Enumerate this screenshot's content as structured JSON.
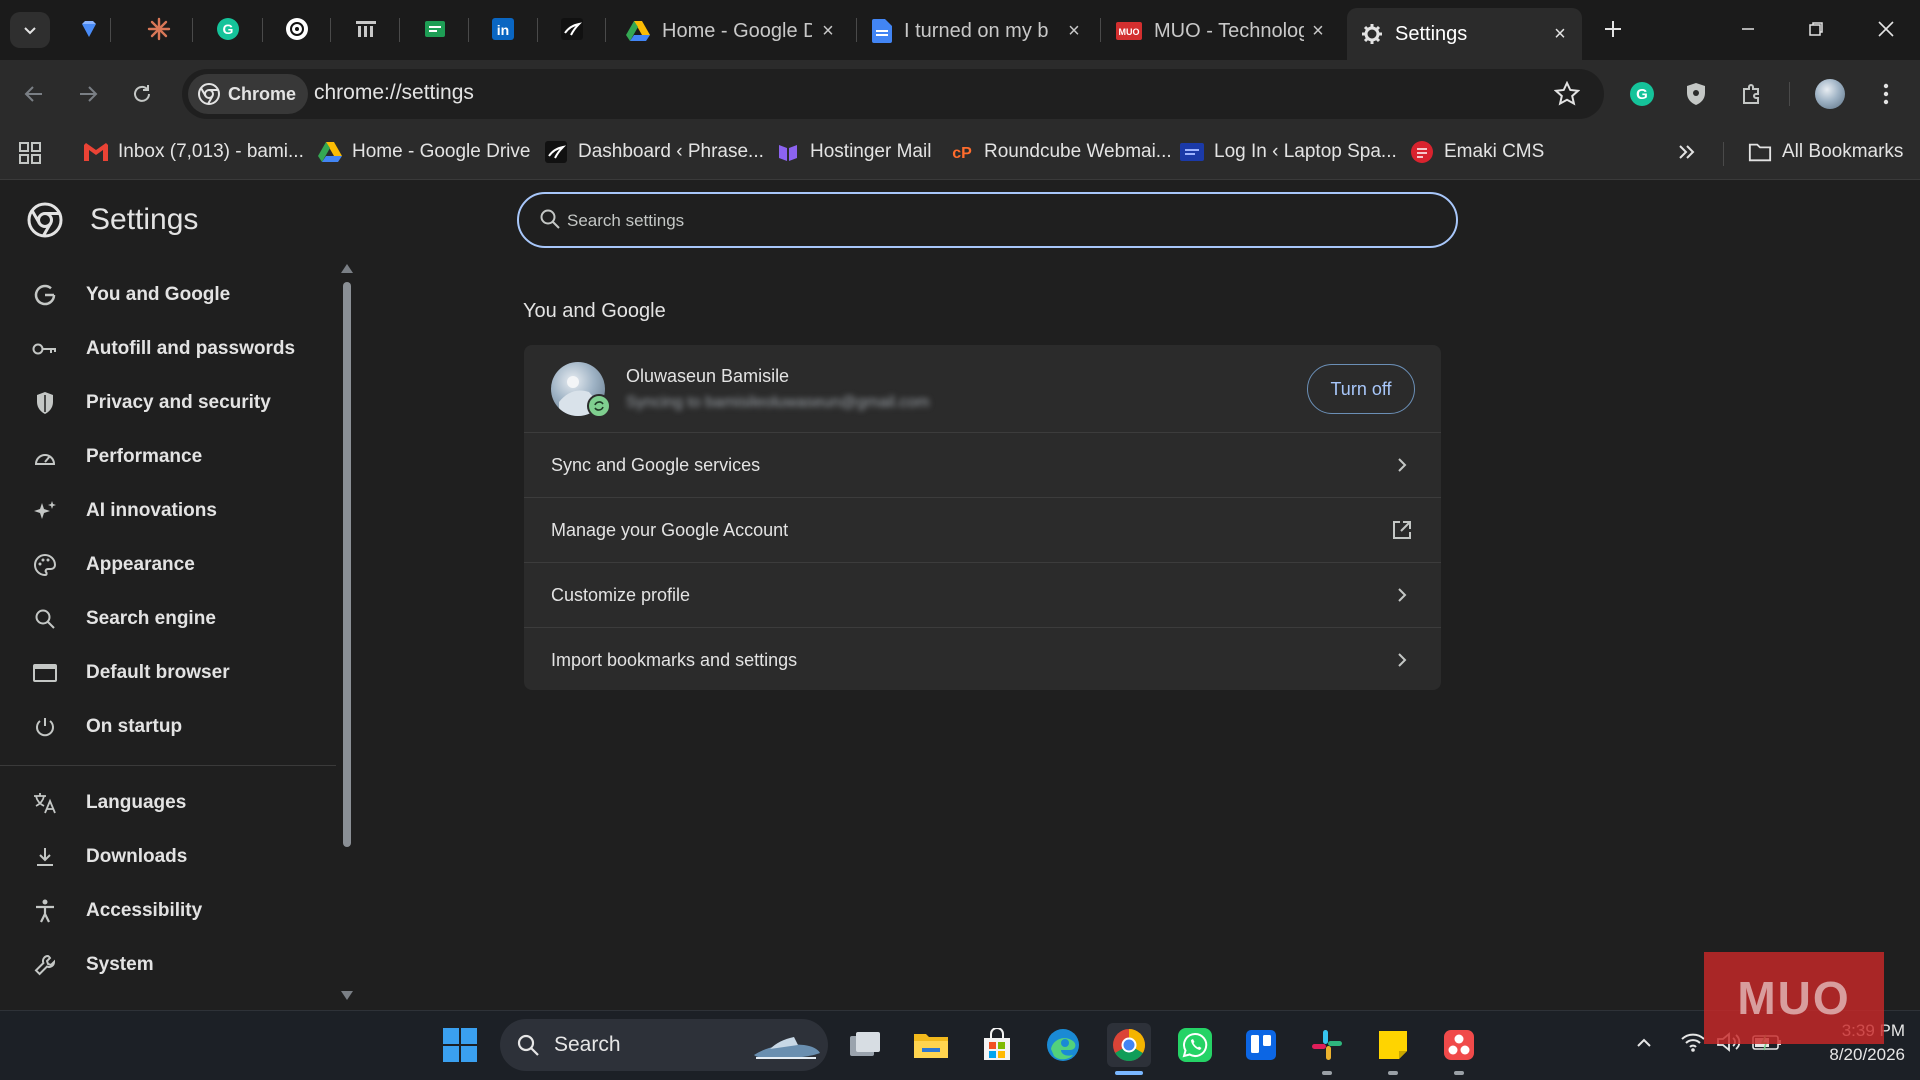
{
  "tabs": {
    "pinned_icons": [
      "gemini-icon",
      "claude-icon",
      "grammarly-icon",
      "chatgpt-icon",
      "columns-icon",
      "sheets-icon",
      "linkedin-icon",
      "site-icon"
    ],
    "open": [
      {
        "title": "Home - Google D",
        "icon": "google-drive-icon"
      },
      {
        "title": "I turned on my b",
        "icon": "google-docs-icon"
      },
      {
        "title": "MUO - Technolog",
        "icon": "muo-icon"
      },
      {
        "title": "Settings",
        "icon": "gear-icon",
        "active": true
      }
    ]
  },
  "toolbar": {
    "chip_label": "Chrome",
    "url": "chrome://settings"
  },
  "bookmarks": {
    "items": [
      {
        "label": "Inbox (7,013) - bami...",
        "icon": "gmail-icon"
      },
      {
        "label": "Home - Google Drive",
        "icon": "google-drive-icon"
      },
      {
        "label": "Dashboard ‹ Phrase...",
        "icon": "site-icon"
      },
      {
        "label": "Hostinger Mail",
        "icon": "hostinger-icon"
      },
      {
        "label": "Roundcube Webmai...",
        "icon": "cpanel-icon"
      },
      {
        "label": "Log In ‹ Laptop Spa...",
        "icon": "site-icon"
      },
      {
        "label": "Emaki CMS",
        "icon": "emaki-icon"
      }
    ],
    "all_bookmarks": "All Bookmarks"
  },
  "sidebar": {
    "title": "Settings",
    "items": [
      {
        "label": "You and Google"
      },
      {
        "label": "Autofill and passwords"
      },
      {
        "label": "Privacy and security"
      },
      {
        "label": "Performance"
      },
      {
        "label": "AI innovations"
      },
      {
        "label": "Appearance"
      },
      {
        "label": "Search engine"
      },
      {
        "label": "Default browser"
      },
      {
        "label": "On startup"
      },
      {
        "label": "Languages"
      },
      {
        "label": "Downloads"
      },
      {
        "label": "Accessibility"
      },
      {
        "label": "System"
      }
    ]
  },
  "main": {
    "search_placeholder": "Search settings",
    "section_title": "You and Google",
    "account": {
      "name": "Oluwaseun Bamisile",
      "email_blurred": "Syncing to bamisileoluwaseun@gmail.com",
      "turn_off": "Turn off"
    },
    "rows": [
      {
        "label": "Sync and Google services",
        "icon": "chevron-right-icon"
      },
      {
        "label": "Manage your Google Account",
        "icon": "external-link-icon"
      },
      {
        "label": "Customize profile",
        "icon": "chevron-right-icon"
      },
      {
        "label": "Import bookmarks and settings",
        "icon": "chevron-right-icon"
      }
    ]
  },
  "taskbar": {
    "search_label": "Search",
    "time": "3:39 PM",
    "date": "8/20/2026"
  },
  "watermark": "MUO",
  "colors": {
    "accent": "#a8c7fa",
    "background": "#1f1f1f",
    "surface": "#2b2b2b"
  }
}
